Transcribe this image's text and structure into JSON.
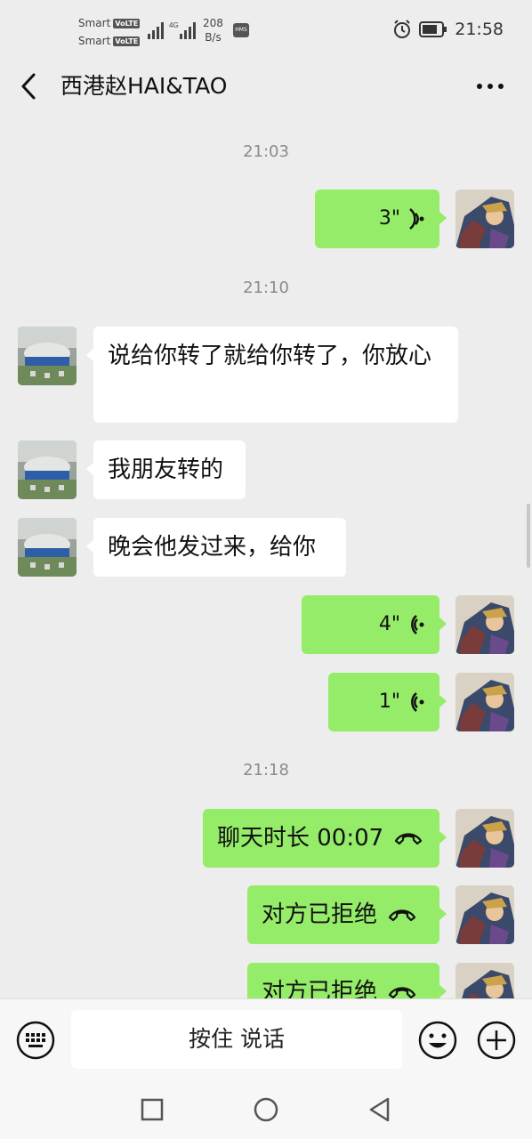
{
  "status_bar": {
    "carrier1": "Smart",
    "carrier2": "Smart",
    "volte_label": "VoLTE",
    "network": "4G",
    "speed_value": "208",
    "speed_unit": "B/s",
    "hms_label": "HMS",
    "time": "21:58"
  },
  "header": {
    "title": "西港赵HAI&TAO"
  },
  "messages": {
    "ts1": "21:03",
    "voice1": "3\"",
    "ts2": "21:10",
    "text1": "说给你转了就给你转了，你放心",
    "text2": "我朋友转的",
    "text3": "晚会他发过来，给你",
    "voice2": "4\"",
    "voice3": "1\"",
    "ts3": "21:18",
    "call1": "聊天时长 00:07",
    "call2": "对方已拒绝",
    "call3": "对方已拒绝"
  },
  "input_bar": {
    "hold_to_talk": "按住 说话"
  },
  "icons": {
    "back": "back-arrow-icon",
    "more": "more-icon",
    "voice": "voice-wave-icon",
    "call": "phone-hangup-icon",
    "keyboard": "keyboard-icon",
    "emoji": "emoji-icon",
    "plus": "plus-icon"
  },
  "colors": {
    "bubble_sent": "#95ec69",
    "bubble_received": "#ffffff",
    "background": "#ededed"
  }
}
